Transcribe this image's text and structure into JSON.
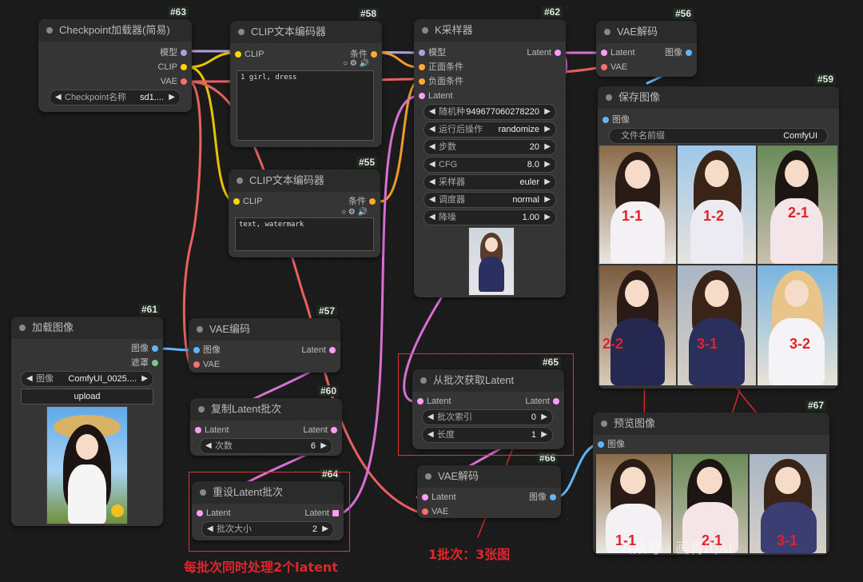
{
  "nodes": {
    "n63": {
      "id": "#63",
      "title": "Checkpoint加载器(简易)",
      "out_model": "模型",
      "out_clip": "CLIP",
      "out_vae": "VAE",
      "w_label": "Checkpoint名称",
      "w_value": "sd1...."
    },
    "n58": {
      "id": "#58",
      "title": "CLIP文本编码器",
      "in_clip": "CLIP",
      "out_cond": "条件",
      "text": "1 girl, dress"
    },
    "n55": {
      "id": "#55",
      "title": "CLIP文本编码器",
      "in_clip": "CLIP",
      "out_cond": "条件",
      "text": "text, watermark"
    },
    "n62": {
      "id": "#62",
      "title": "K采样器",
      "in_model": "模型",
      "in_pos": "正面条件",
      "in_neg": "负面条件",
      "in_latent": "Latent",
      "out_latent": "Latent",
      "widgets": [
        {
          "label": "随机种",
          "value": "949677060278220"
        },
        {
          "label": "运行后操作",
          "value": "randomize"
        },
        {
          "label": "步数",
          "value": "20"
        },
        {
          "label": "CFG",
          "value": "8.0"
        },
        {
          "label": "采样器",
          "value": "euler"
        },
        {
          "label": "调度器",
          "value": "normal"
        },
        {
          "label": "降噪",
          "value": "1.00"
        }
      ]
    },
    "n56": {
      "id": "#56",
      "title": "VAE解码",
      "in_latent": "Latent",
      "in_vae": "VAE",
      "out_image": "图像"
    },
    "n59": {
      "id": "#59",
      "title": "保存图像",
      "in_image": "图像",
      "w_label": "文件名前缀",
      "w_value": "ComfyUI"
    },
    "n61": {
      "id": "#61",
      "title": "加载图像",
      "out_image": "图像",
      "out_mask": "遮罩",
      "w_label": "图像",
      "w_value": "ComfyUI_0025....",
      "upload": "upload"
    },
    "n57": {
      "id": "#57",
      "title": "VAE编码",
      "in_image": "图像",
      "in_vae": "VAE",
      "out_latent": "Latent"
    },
    "n60": {
      "id": "#60",
      "title": "复制Latent批次",
      "in_latent": "Latent",
      "out_latent": "Latent",
      "w_label": "次数",
      "w_value": "6"
    },
    "n64": {
      "id": "#64",
      "title": "重设Latent批次",
      "in_latent": "Latent",
      "out_latent": "Latent",
      "w_label": "批次大小",
      "w_value": "2"
    },
    "n65": {
      "id": "#65",
      "title": "从批次获取Latent",
      "in_latent": "Latent",
      "out_latent": "Latent",
      "w1_label": "批次索引",
      "w1_value": "0",
      "w2_label": "长度",
      "w2_value": "1"
    },
    "n66": {
      "id": "#66",
      "title": "VAE解码",
      "in_latent": "Latent",
      "in_vae": "VAE",
      "out_image": "图像"
    },
    "n67": {
      "id": "#67",
      "title": "预览图像",
      "in_image": "图像"
    }
  },
  "save_grid_labels": [
    "1-1",
    "1-2",
    "2-1",
    "2-2",
    "3-1",
    "3-2"
  ],
  "preview_labels": [
    "1-1",
    "2-1",
    "3-1"
  ],
  "annotations": {
    "note_batch": "每批次同时处理2个latent",
    "note_images": "1批次：3张图"
  },
  "watermark": "公众号 · 画青山AI",
  "colors": {
    "model": "#b39ddb",
    "clip": "#ffd500",
    "vae": "#ff6e6e",
    "cond": "#ffa931",
    "latent": "#ff9cf9",
    "image": "#64b5f6",
    "mask": "#81c784"
  }
}
